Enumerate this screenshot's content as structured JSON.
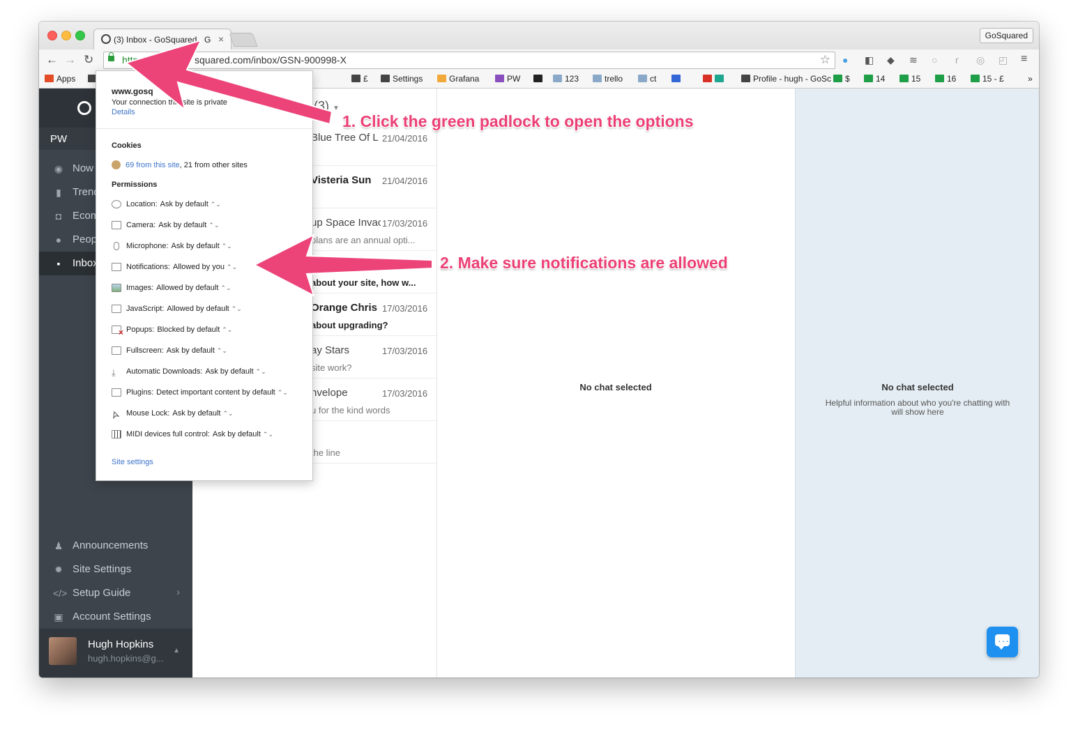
{
  "browser": {
    "tab_title": "(3) Inbox - GoSquared - Go",
    "profile_button": "GoSquared",
    "url_protocol": "https://",
    "url_rest": "squared.com/inbox/GSN-900998-X",
    "bookmarks": [
      {
        "label": "Apps",
        "color": "#e34c26"
      },
      {
        "label": "Chat",
        "color": "#444444"
      },
      {
        "label": "£",
        "color": "#444444"
      },
      {
        "label": "Settings",
        "color": "#444444"
      },
      {
        "label": "Grafana",
        "color": "#f2a93b"
      },
      {
        "label": "PW",
        "color": "#8a4fbf"
      },
      {
        "label": "",
        "color": "#222222"
      },
      {
        "label": "123",
        "color": "#8aa9c9"
      },
      {
        "label": "trello",
        "color": "#8aa9c9"
      },
      {
        "label": "ct",
        "color": "#8aa9c9"
      },
      {
        "label": "",
        "color": "#3367d6"
      },
      {
        "label": "",
        "color": "#d93025"
      },
      {
        "label": "",
        "color": "#1fa68f"
      },
      {
        "label": "Profile - hugh - GoSc",
        "color": "#444444"
      },
      {
        "label": "$",
        "color": "#1e9e47"
      },
      {
        "label": "14",
        "color": "#1e9e47"
      },
      {
        "label": "15",
        "color": "#1e9e47"
      },
      {
        "label": "16",
        "color": "#1e9e47"
      },
      {
        "label": "15 - £",
        "color": "#1e9e47"
      }
    ],
    "bookmarks_more": "»"
  },
  "sidebar": {
    "project": "PW",
    "nav": [
      {
        "label": "Now",
        "icon": "now-icon"
      },
      {
        "label": "Trends",
        "icon": "trends-icon"
      },
      {
        "label": "Ecommerce",
        "icon": "ecommerce-icon"
      },
      {
        "label": "People",
        "icon": "people-icon"
      },
      {
        "label": "Inbox",
        "icon": "inbox-icon"
      }
    ],
    "bottom_nav": [
      {
        "label": "Announcements",
        "icon": "bell-icon"
      },
      {
        "label": "Site Settings",
        "icon": "gear-icon"
      },
      {
        "label": "Setup Guide",
        "icon": "code-icon"
      },
      {
        "label": "Account Settings",
        "icon": "account-icon"
      }
    ],
    "user": {
      "name": "Hugh Hopkins",
      "email": "hugh.hopkins@g..."
    }
  },
  "inbox": {
    "title": "x (3)",
    "conversations": [
      {
        "name": "Blue Tree Of L",
        "date": "21/04/2016",
        "preview": "",
        "bold_name": false,
        "bold_preview": false
      },
      {
        "name": "Visteria Sun",
        "date": "21/04/2016",
        "preview": "",
        "bold_name": true,
        "bold_preview": false
      },
      {
        "name": "up Space Invac",
        "date": "17/03/2016",
        "preview": "plans are an annual opti...",
        "bold_name": false,
        "bold_preview": false
      },
      {
        "name": "",
        "date": "",
        "preview": "about your site, how w...",
        "bold_name": false,
        "bold_preview": true
      },
      {
        "name": "Orange Chris",
        "date": "17/03/2016",
        "preview": "about upgrading?",
        "bold_name": true,
        "bold_preview": true
      },
      {
        "name": "ay Stars",
        "date": "17/03/2016",
        "preview": "site work?",
        "bold_name": false,
        "bold_preview": false
      },
      {
        "name": "nvelope",
        "date": "17/03/2016",
        "preview": "u for the kind words",
        "bold_name": false,
        "bold_preview": false
      },
      {
        "name": "",
        "date": "",
        "preview": "the line",
        "bold_name": false,
        "bold_preview": false
      }
    ]
  },
  "chat": {
    "empty_title": "No chat selected"
  },
  "info": {
    "empty_title": "No chat selected",
    "empty_subtitle": "Helpful information about who you're chatting with will show here"
  },
  "popup": {
    "host": "www.gosq",
    "connection": "Your connection   this site is private",
    "details_link": "Details",
    "cookies_heading": "Cookies",
    "cookies_link": "69 from this site",
    "cookies_rest": ", 21 from other sites",
    "permissions_heading": "Permissions",
    "permissions": [
      {
        "label": "Location:",
        "value": "Ask by default",
        "icon": "location-icon"
      },
      {
        "label": "Camera:",
        "value": "Ask by default",
        "icon": "camera-icon"
      },
      {
        "label": "Microphone:",
        "value": "Ask by default",
        "icon": "microphone-icon"
      },
      {
        "label": "Notifications:",
        "value": "Allowed by you",
        "icon": "notifications-icon"
      },
      {
        "label": "Images:",
        "value": "Allowed by default",
        "icon": "image-icon"
      },
      {
        "label": "JavaScript:",
        "value": "Allowed by default",
        "icon": "javascript-icon"
      },
      {
        "label": "Popups:",
        "value": "Blocked by default",
        "icon": "popup-blocked-icon"
      },
      {
        "label": "Fullscreen:",
        "value": "Ask by default",
        "icon": "fullscreen-icon"
      },
      {
        "label": "Automatic Downloads:",
        "value": "Ask by default",
        "icon": "download-icon"
      },
      {
        "label": "Plugins:",
        "value": "Detect important content by default",
        "icon": "plugin-icon"
      },
      {
        "label": "Mouse Lock:",
        "value": "Ask by default",
        "icon": "mouse-lock-icon"
      },
      {
        "label": "MIDI devices full control:",
        "value": "Ask by default",
        "icon": "midi-icon"
      }
    ],
    "site_settings_link": "Site settings"
  },
  "annotations": {
    "step1": "1. Click the green padlock to open the options",
    "step2": "2. Make sure notifications are allowed",
    "color": "#ec3f75"
  }
}
